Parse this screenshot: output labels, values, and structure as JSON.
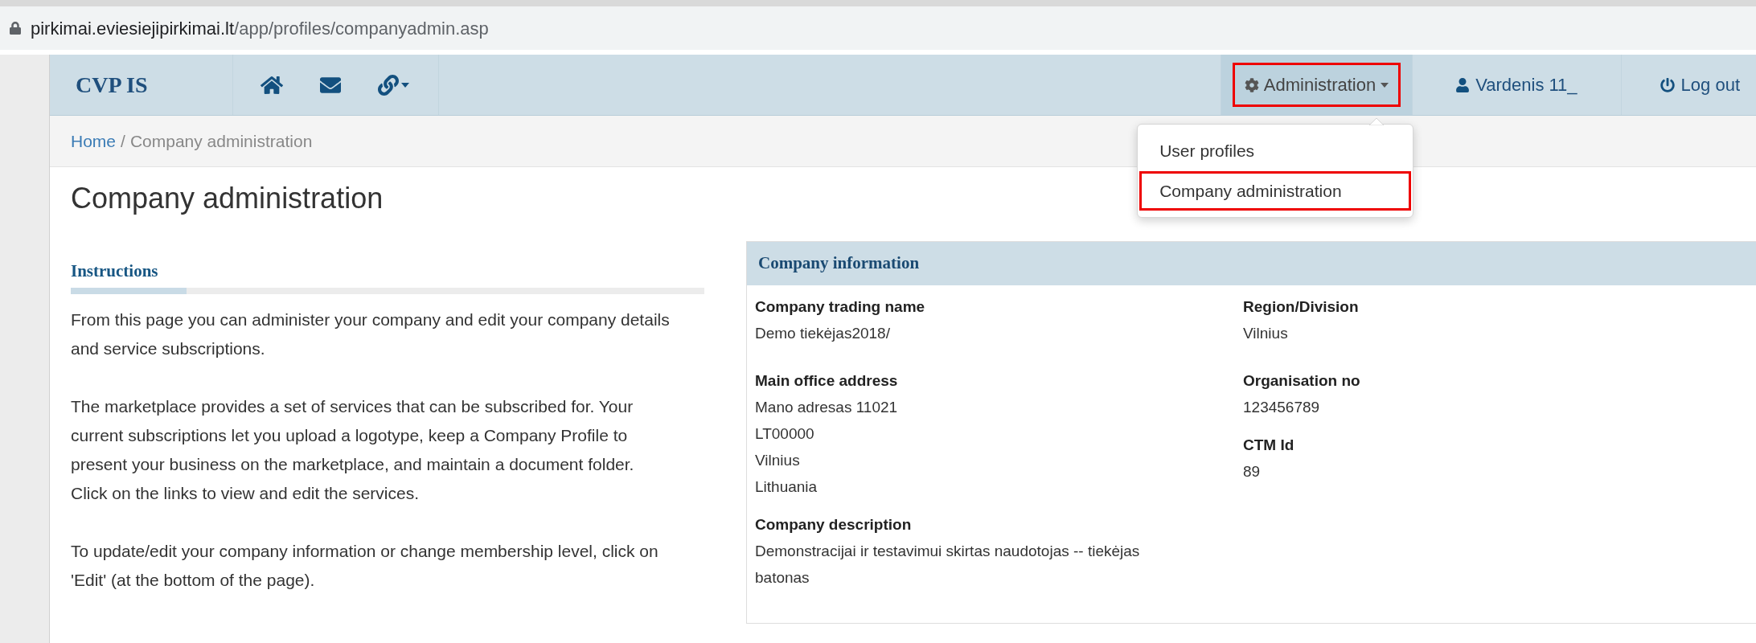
{
  "browser": {
    "url_host": "pirkimai.eviesiejipirkimai.lt",
    "url_path": "/app/profiles/companyadmin.asp"
  },
  "navbar": {
    "brand": "CVP IS",
    "admin": {
      "label": "Administration",
      "expanded": true,
      "highlighted": true
    },
    "user": {
      "label": "Vardenis 11_"
    },
    "logout": {
      "label": "Log out"
    }
  },
  "dropdown": [
    {
      "label": "User profiles",
      "highlighted": false
    },
    {
      "label": "Company administration",
      "highlighted": true
    }
  ],
  "breadcrumb": {
    "items": [
      {
        "label": "Home",
        "link": true
      },
      {
        "label": "Company administration",
        "link": false
      }
    ],
    "separator": "/"
  },
  "page_title": "Company administration",
  "instructions": {
    "title": "Instructions",
    "paragraphs": [
      "From this page you can administer your company and edit your company details and service subscriptions.",
      "The marketplace provides a set of services that can be subscribed for. Your current subscriptions let you upload a logotype, keep a Company Profile to present your business on the marketplace, and maintain a document folder. Click on the links to view and edit the services.",
      "To update/edit your company information or change membership level, click on 'Edit' (at the bottom of the page)."
    ]
  },
  "company_info": {
    "title": "Company information",
    "left_fields": [
      {
        "label": "Company trading name",
        "lines": [
          "Demo tiekėjas2018/"
        ]
      },
      {
        "label": "Main office address",
        "lines": [
          "Mano adresas 11021",
          "LT00000",
          "Vilnius",
          "Lithuania"
        ]
      }
    ],
    "right_fields": [
      {
        "label": "Region/Division",
        "lines": [
          "Vilnius"
        ]
      },
      {
        "label": "Organisation no",
        "lines": [
          "123456789"
        ]
      },
      {
        "label": "CTM Id",
        "lines": [
          "89"
        ]
      }
    ],
    "description": {
      "label": "Company description",
      "lines": [
        "Demonstracijai ir testavimui skirtas naudotojas -- tiekėjas",
        "batonas"
      ]
    }
  }
}
